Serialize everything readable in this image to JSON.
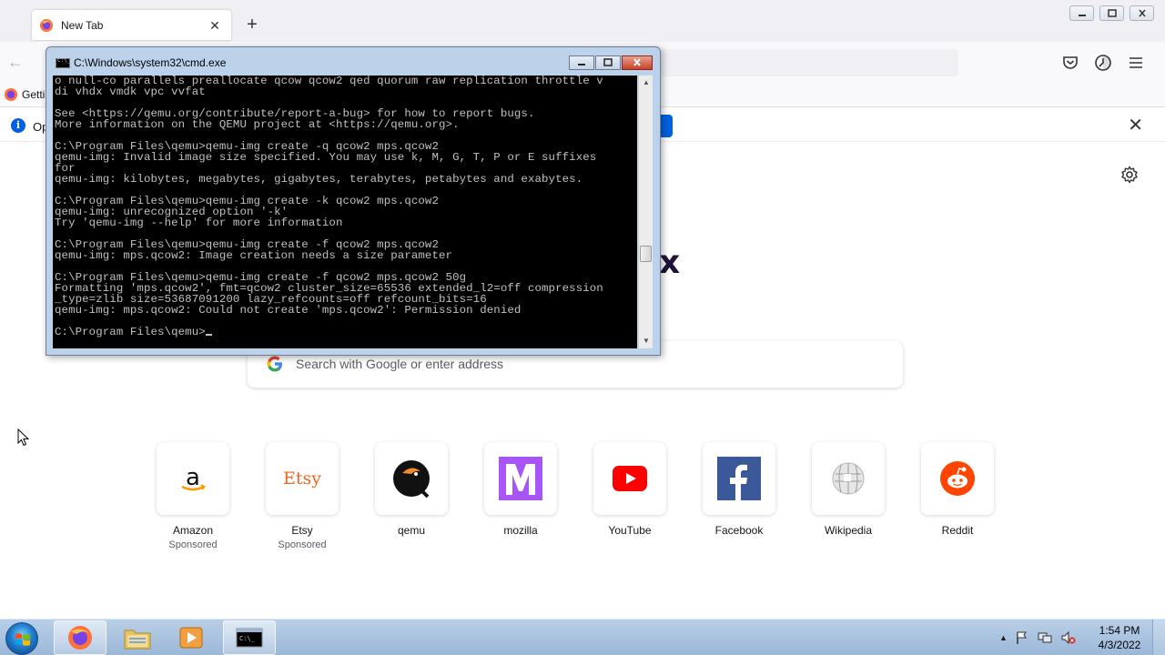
{
  "browser": {
    "tab_title": "New Tab",
    "bookmark_label": "Getti",
    "notice_text": "Op",
    "search_placeholder": "Search with Google or enter address",
    "brand_fragment": "x",
    "top_sites": [
      {
        "name": "Amazon",
        "sponsored": "Sponsored"
      },
      {
        "name": "Etsy",
        "sponsored": "Sponsored"
      },
      {
        "name": "qemu",
        "sponsored": ""
      },
      {
        "name": "mozilla",
        "sponsored": ""
      },
      {
        "name": "YouTube",
        "sponsored": ""
      },
      {
        "name": "Facebook",
        "sponsored": ""
      },
      {
        "name": "Wikipedia",
        "sponsored": ""
      },
      {
        "name": "Reddit",
        "sponsored": ""
      }
    ],
    "etsy_logo_text": "Etsy"
  },
  "cmd": {
    "title": "C:\\Windows\\system32\\cmd.exe",
    "lines": [
      "o null-co parallels preallocate qcow qcow2 qed quorum raw replication throttle v",
      "di vhdx vmdk vpc vvfat",
      "",
      "See <https://qemu.org/contribute/report-a-bug> for how to report bugs.",
      "More information on the QEMU project at <https://qemu.org>.",
      "",
      "C:\\Program Files\\qemu>qemu-img create -q qcow2 mps.qcow2",
      "qemu-img: Invalid image size specified. You may use k, M, G, T, P or E suffixes",
      "for",
      "qemu-img: kilobytes, megabytes, gigabytes, terabytes, petabytes and exabytes.",
      "",
      "C:\\Program Files\\qemu>qemu-img create -k qcow2 mps.qcow2",
      "qemu-img: unrecognized option '-k'",
      "Try 'qemu-img --help' for more information",
      "",
      "C:\\Program Files\\qemu>qemu-img create -f qcow2 mps.qcow2",
      "qemu-img: mps.qcow2: Image creation needs a size parameter",
      "",
      "C:\\Program Files\\qemu>qemu-img create -f qcow2 mps.qcow2 50g",
      "Formatting 'mps.qcow2', fmt=qcow2 cluster_size=65536 extended_l2=off compression",
      "_type=zlib size=53687091200 lazy_refcounts=off refcount_bits=16",
      "qemu-img: mps.qcow2: Could not create 'mps.qcow2': Permission denied",
      "",
      "C:\\Program Files\\qemu>"
    ]
  },
  "taskbar": {
    "time": "1:54 PM",
    "date": "4/3/2022"
  },
  "colors": {
    "firefox_accent": "#0061e0",
    "youtube_red": "#ff0000",
    "facebook_blue": "#3b5998",
    "reddit_orange": "#ff4500",
    "mozilla_purple": "#a855f7",
    "cmd_text": "#c0c0c0"
  },
  "icons": [
    "firefox-icon",
    "new-tab-plus-icon",
    "back-arrow-icon",
    "pocket-icon",
    "account-icon",
    "hamburger-menu-icon",
    "info-icon",
    "close-icon",
    "gear-icon",
    "google-icon",
    "cmd-icon",
    "windows-start-icon",
    "explorer-icon",
    "media-player-icon",
    "flag-icon",
    "network-icon",
    "speaker-muted-icon",
    "mouse-cursor-icon"
  ]
}
